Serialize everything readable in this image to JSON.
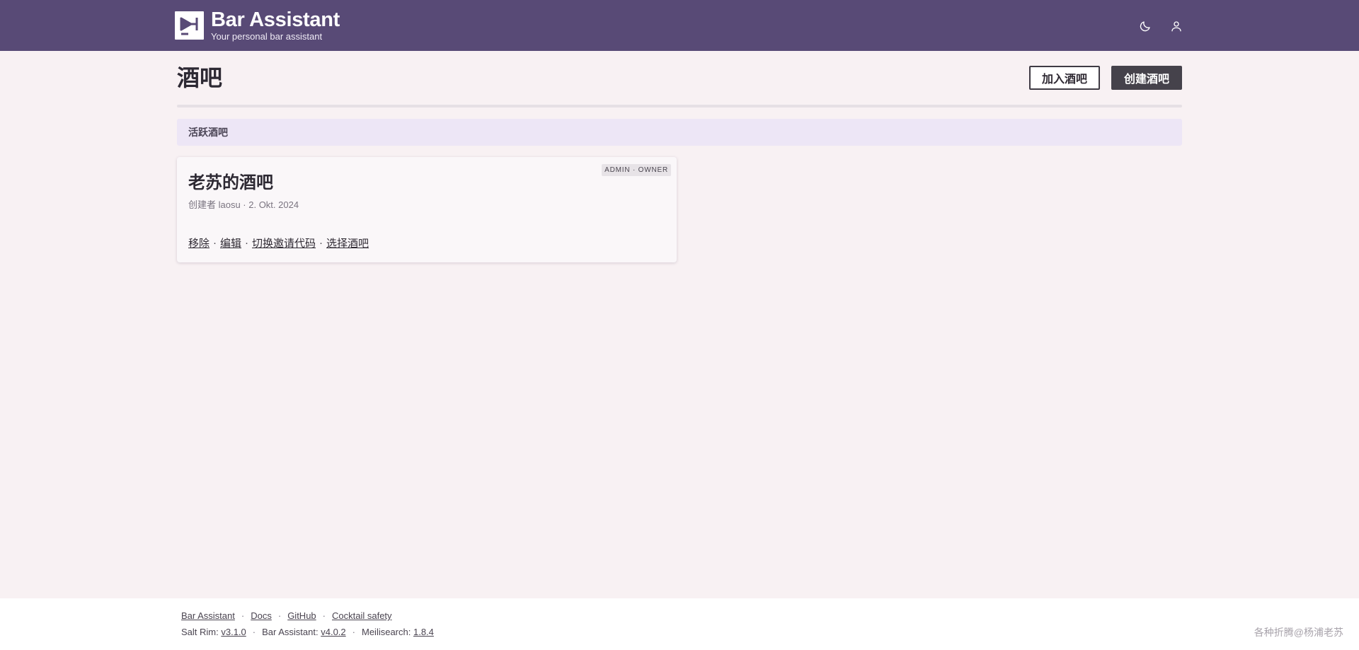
{
  "header": {
    "brand_title": "Bar Assistant",
    "brand_subtitle": "Your personal bar assistant",
    "icons": [
      "moon-icon",
      "user-icon"
    ],
    "color": "#584a76"
  },
  "page": {
    "title": "酒吧",
    "join_button": "加入酒吧",
    "create_button": "创建酒吧"
  },
  "section": {
    "label": "活跃酒吧"
  },
  "bar_card": {
    "name": "老苏的酒吧",
    "badge": "ADMIN · OWNER",
    "meta": "创建者 laosu · 2. Okt. 2024",
    "actions": {
      "remove": "移除",
      "edit": "编辑",
      "toggle_invite": "切换邀请代码",
      "select": "选择酒吧"
    }
  },
  "footer": {
    "links": [
      "Bar Assistant",
      "Docs",
      "GitHub",
      "Cocktail safety"
    ],
    "versions": [
      {
        "label": "Salt Rim:",
        "value": "v3.1.0"
      },
      {
        "label": "Bar Assistant:",
        "value": "v4.0.2"
      },
      {
        "label": "Meilisearch:",
        "value": "1.8.4"
      }
    ],
    "watermark": "各种折腾@杨浦老苏"
  }
}
